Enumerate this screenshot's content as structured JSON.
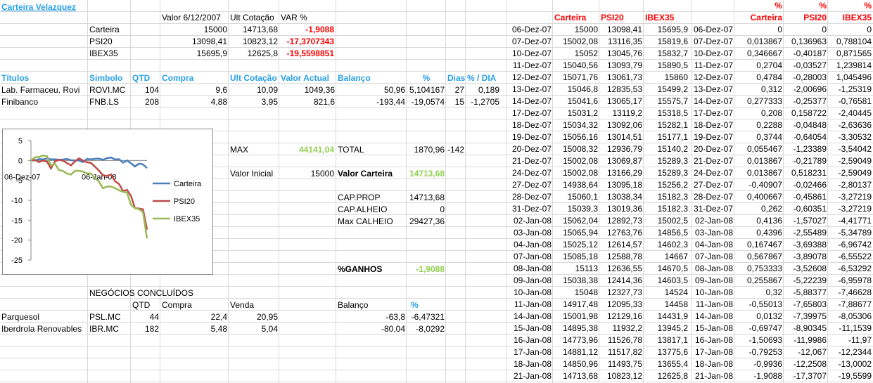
{
  "title": "Carteira Velazquez",
  "summary": {
    "headers": [
      "Valor 6/12/2007",
      "Ult Cotação",
      "VAR %"
    ],
    "rows": [
      {
        "name": "Carteira",
        "valor": "15000",
        "ult": "14713,68",
        "var": "-1,9088"
      },
      {
        "name": "PSI20",
        "valor": "13098,41",
        "ult": "10823,12",
        "var": "-17,3707343"
      },
      {
        "name": "IBEX35",
        "valor": "15695,9",
        "ult": "12625,8",
        "var": "-19,5598851"
      }
    ]
  },
  "holdings": {
    "headers": [
      "Títulos",
      "Simbolo",
      "QTD",
      "Compra",
      "Ult Cotação",
      "Valor Actual",
      "Balanço",
      "%",
      "Dias",
      "% / DIA"
    ],
    "rows": [
      [
        "Lab. Farmaceu. Rovi",
        "ROVI.MC",
        "104",
        "9,6",
        "10,09",
        "1049,36",
        "50,96",
        "5,104167",
        "27",
        "0,189"
      ],
      [
        "Finibanco",
        "FNB.LS",
        "208",
        "4,88",
        "3,95",
        "821,6",
        "-193,44",
        "-19,0574",
        "15",
        "-1,2705"
      ]
    ]
  },
  "stats": {
    "max_label": "MAX",
    "max_value": "44141,04",
    "total_label": "TOTAL",
    "total_value": "1870,96",
    "total_extra": "-142",
    "valor_inicial_label": "Valor Inicial",
    "valor_inicial": "15000",
    "valor_carteira_label": "Valor Carteira",
    "valor_carteira": "14713,68",
    "cap_prop_label": "CAP.PROP",
    "cap_prop": "14713,68",
    "cap_alheio_label": "CAP.ALHEIO",
    "cap_alheio": "0",
    "max_calheio_label": "Max CALHEIO",
    "max_calheio": "29427,36",
    "ganhos_label": "%GANHOS",
    "ganhos": "-1,9088"
  },
  "closed": {
    "title": "NEGÓCIOS CONCLUÍDOS",
    "headers": [
      "QTD",
      "Compra",
      "Venda",
      "Balanço",
      "%"
    ],
    "rows": [
      [
        "Parquesol",
        "PSL.MC",
        "44",
        "22,4",
        "20,95",
        "-63,8",
        "-6,47321"
      ],
      [
        "Iberdrola Renovables",
        "IBR.MC",
        "182",
        "5,48",
        "5,04",
        "-80,04",
        "-8,0292"
      ]
    ]
  },
  "history": {
    "headers": [
      "Carteira",
      "PSI20",
      "IBEX35"
    ],
    "pct_header_top": "%",
    "pct_headers": [
      "Carteira",
      "PSI20",
      "IBEX35"
    ],
    "rows": [
      [
        "06-Dez-07",
        "15000",
        "13098,41",
        "15695,9",
        "06-Dez-07",
        "0",
        "0",
        "0"
      ],
      [
        "07-Dez-07",
        "15002,08",
        "13116,35",
        "15819,6",
        "07-Dez-07",
        "0,013867",
        "0,136963",
        "0,788104"
      ],
      [
        "10-Dez-07",
        "15052",
        "13045,76",
        "15832,7",
        "10-Dez-07",
        "0,346667",
        "-0,40187",
        "0,871565"
      ],
      [
        "11-Dez-07",
        "15040,56",
        "13093,79",
        "15890,5",
        "11-Dez-07",
        "0,2704",
        "-0,03527",
        "1,239814"
      ],
      [
        "12-Dez-07",
        "15071,76",
        "13061,73",
        "15860",
        "12-Dez-07",
        "0,4784",
        "-0,28003",
        "1,045496"
      ],
      [
        "13-Dez-07",
        "15046,8",
        "12835,53",
        "15499,2",
        "13-Dez-07",
        "0,312",
        "-2,00696",
        "-1,25319"
      ],
      [
        "14-Dez-07",
        "15041,6",
        "13065,17",
        "15575,7",
        "14-Dez-07",
        "0,277333",
        "-0,25377",
        "-0,76581"
      ],
      [
        "17-Dez-07",
        "15031,2",
        "13119,2",
        "15318,5",
        "17-Dez-07",
        "0,208",
        "0,158722",
        "-2,40445"
      ],
      [
        "18-Dez-07",
        "15034,32",
        "13092,06",
        "15282,1",
        "18-Dez-07",
        "0,2288",
        "-0,04848",
        "-2,63636"
      ],
      [
        "19-Dez-07",
        "15056,16",
        "13014,51",
        "15177,1",
        "19-Dez-07",
        "0,3744",
        "-0,64054",
        "-3,30532"
      ],
      [
        "20-Dez-07",
        "15008,32",
        "12936,79",
        "15140,2",
        "20-Dez-07",
        "0,055467",
        "-1,23389",
        "-3,54042"
      ],
      [
        "21-Dez-07",
        "15002,08",
        "13069,87",
        "15289,3",
        "21-Dez-07",
        "0,013867",
        "-0,21789",
        "-2,59049"
      ],
      [
        "24-Dez-07",
        "15002,08",
        "13166,29",
        "15289,3",
        "24-Dez-07",
        "0,013867",
        "0,518231",
        "-2,59049"
      ],
      [
        "27-Dez-07",
        "14938,64",
        "13095,18",
        "15256,2",
        "27-Dez-07",
        "-0,40907",
        "-0,02466",
        "-2,80137"
      ],
      [
        "28-Dez-07",
        "15060,1",
        "13038,34",
        "15182,3",
        "28-Dez-07",
        "0,400667",
        "-0,45861",
        "-3,27219"
      ],
      [
        "31-Dez-07",
        "15039,3",
        "13019,36",
        "15182,3",
        "31-Dez-07",
        "0,262",
        "-0,60351",
        "-3,27219"
      ],
      [
        "02-Jan-08",
        "15062,04",
        "12892,73",
        "15002,5",
        "02-Jan-08",
        "0,4136",
        "-1,57027",
        "-4,41771"
      ],
      [
        "03-Jan-08",
        "15065,94",
        "12763,76",
        "14856,5",
        "03-Jan-08",
        "0,4396",
        "-2,55489",
        "-5,34789"
      ],
      [
        "04-Jan-08",
        "15025,12",
        "12614,57",
        "14602,3",
        "04-Jan-08",
        "0,167467",
        "-3,69388",
        "-6,96742"
      ],
      [
        "07-Jan-08",
        "15085,18",
        "12588,78",
        "14667",
        "07-Jan-08",
        "0,567867",
        "-3,89078",
        "-6,55522"
      ],
      [
        "08-Jan-08",
        "15113",
        "12636,55",
        "14670,5",
        "08-Jan-08",
        "0,753333",
        "-3,52608",
        "-6,53292"
      ],
      [
        "09-Jan-08",
        "15038,38",
        "12414,36",
        "14603,5",
        "09-Jan-08",
        "0,255867",
        "-5,22239",
        "-6,95978"
      ],
      [
        "10-Jan-08",
        "15048",
        "12327,73",
        "14524",
        "10-Jan-08",
        "0,32",
        "-5,88377",
        "-7,46628"
      ],
      [
        "11-Jan-08",
        "14917,48",
        "12095,33",
        "14458",
        "11-Jan-08",
        "-0,55013",
        "-7,65803",
        "-7,88677"
      ],
      [
        "14-Jan-08",
        "15001,98",
        "12129,16",
        "14431,9",
        "14-Jan-08",
        "0,0132",
        "-7,39975",
        "-8,05306"
      ],
      [
        "15-Jan-08",
        "14895,38",
        "11932,2",
        "13945,2",
        "15-Jan-08",
        "-0,69747",
        "-8,90345",
        "-11,1539"
      ],
      [
        "16-Jan-08",
        "14773,96",
        "11526,78",
        "13817,1",
        "16-Jan-08",
        "-1,50693",
        "-11,9986",
        "-11,97"
      ],
      [
        "17-Jan-08",
        "14881,12",
        "11517,82",
        "13775,6",
        "17-Jan-08",
        "-0,79253",
        "-12,067",
        "-12,2344"
      ],
      [
        "18-Jan-08",
        "14850,96",
        "11493,75",
        "13655,4",
        "18-Jan-08",
        "-0,9936",
        "-12,2508",
        "-13,0002"
      ],
      [
        "21-Jan-08",
        "14713,68",
        "10823,12",
        "12625,8",
        "21-Jan-08",
        "-1,9088",
        "-17,3707",
        "-19,5599"
      ]
    ]
  },
  "chart_data": {
    "type": "line",
    "x": [
      "06-Dez-07",
      "07-Dez-07",
      "10-Dez-07",
      "11-Dez-07",
      "12-Dez-07",
      "13-Dez-07",
      "14-Dez-07",
      "17-Dez-07",
      "18-Dez-07",
      "19-Dez-07",
      "20-Dez-07",
      "21-Dez-07",
      "24-Dez-07",
      "27-Dez-07",
      "28-Dez-07",
      "31-Dez-07",
      "02-Jan-08",
      "03-Jan-08",
      "04-Jan-08",
      "07-Jan-08",
      "08-Jan-08",
      "09-Jan-08",
      "10-Jan-08",
      "11-Jan-08",
      "14-Jan-08",
      "15-Jan-08",
      "16-Jan-08",
      "17-Jan-08",
      "18-Jan-08",
      "21-Jan-08"
    ],
    "x_tick_labels": [
      "06-Dez-07",
      "06-Jan-08"
    ],
    "ylim": [
      -25,
      5
    ],
    "y_ticks": [
      5,
      0,
      -5,
      -10,
      -15,
      -20,
      -25
    ],
    "legend_position": "right",
    "series": [
      {
        "name": "Carteira",
        "color": "#4a7ebb",
        "values": [
          0,
          0.014,
          0.347,
          0.27,
          0.478,
          0.312,
          0.277,
          0.208,
          0.229,
          0.374,
          0.055,
          0.014,
          0.014,
          -0.409,
          0.401,
          0.262,
          0.414,
          0.44,
          0.167,
          0.568,
          0.753,
          0.256,
          0.32,
          -0.55,
          0.013,
          -0.697,
          -1.507,
          -0.793,
          -0.994,
          -1.909
        ]
      },
      {
        "name": "PSI20",
        "color": "#be4b48",
        "values": [
          0,
          0.137,
          -0.402,
          -0.035,
          -0.28,
          -2.007,
          -0.254,
          0.159,
          -0.048,
          -0.641,
          -1.234,
          -0.218,
          0.518,
          -0.025,
          -0.459,
          -0.604,
          -1.57,
          -2.555,
          -3.694,
          -3.891,
          -3.526,
          -5.222,
          -5.884,
          -7.658,
          -7.4,
          -8.903,
          -11.999,
          -12.067,
          -12.251,
          -17.371
        ]
      },
      {
        "name": "IBEX35",
        "color": "#98b954",
        "values": [
          0,
          0.788,
          0.872,
          1.24,
          1.045,
          -1.253,
          -0.766,
          -2.404,
          -2.636,
          -3.305,
          -3.54,
          -2.59,
          -2.59,
          -2.801,
          -3.272,
          -3.272,
          -4.418,
          -5.348,
          -6.967,
          -6.555,
          -6.533,
          -6.96,
          -7.466,
          -7.887,
          -8.053,
          -11.154,
          -11.97,
          -12.234,
          -13.0,
          -19.56
        ]
      }
    ]
  }
}
